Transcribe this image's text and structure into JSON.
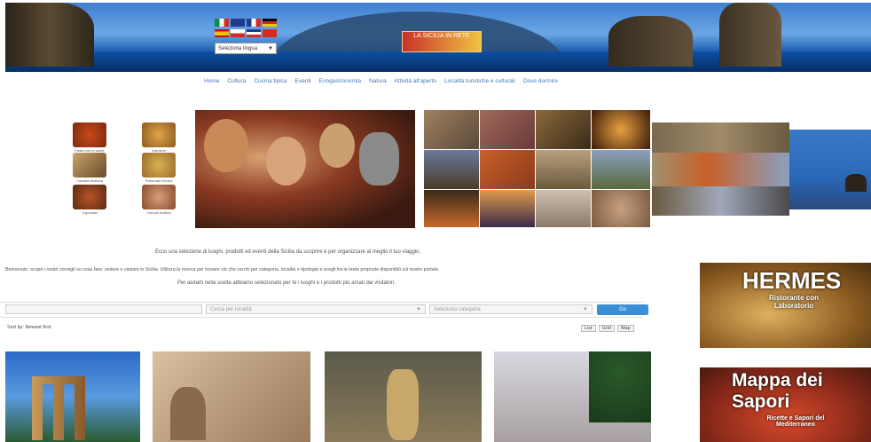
{
  "header": {
    "language_select": "Seleziona lingua",
    "logo_text": "LA SICILIA IN RETE"
  },
  "nav": {
    "items": [
      "Home",
      "Cultura",
      "Cucina tipica",
      "Eventi",
      "Enogastronomia",
      "Natura",
      "Attività all'aperto",
      "Località turistiche e culturali",
      "Dove dormire"
    ]
  },
  "food": {
    "captions": [
      "Pasta con le sarde",
      "Arancine",
      "Cassata siciliana",
      "Pasta alla Norma",
      "Caponata",
      "Cannoli siciliani"
    ]
  },
  "intro": {
    "line1": "Ecco una selezione di luoghi, prodotti ed eventi della Sicilia da scoprire e per organizzare al meglio il tuo viaggio.",
    "line2": "Benvenuto: scopri i nostri consigli su cosa fare, vedere e visitare in Sicilia. Utilizza la ricerca per trovare ciò che cerchi per categoria, località e tipologia e scegli tra le tante proposte disponibili sul nostro portale.",
    "line3": "Per aiutarti nella scelta abbiamo selezionato per te i luoghi e i prodotti più amati dai visitatori."
  },
  "search": {
    "keyword_placeholder": "",
    "location_placeholder": "Cerca per località",
    "category_placeholder": "Seleziona categoria",
    "button_label": "Go"
  },
  "toolbar": {
    "sort_label": "Sort by: Newest first",
    "view_buttons": [
      "List",
      "Grid",
      "Map"
    ]
  },
  "ads": {
    "ad1_title": "HERMES",
    "ad1_subtitle": "Ristorante con Laboratorio",
    "ad2_title": "Mappa dei Sapori",
    "ad2_subtitle": "Ricette e Sapori del Mediterraneo"
  },
  "colors": {
    "accent": "#3b8fd6",
    "nav_link": "#4a7ab5",
    "banner_sky": "#3f7fd0"
  }
}
